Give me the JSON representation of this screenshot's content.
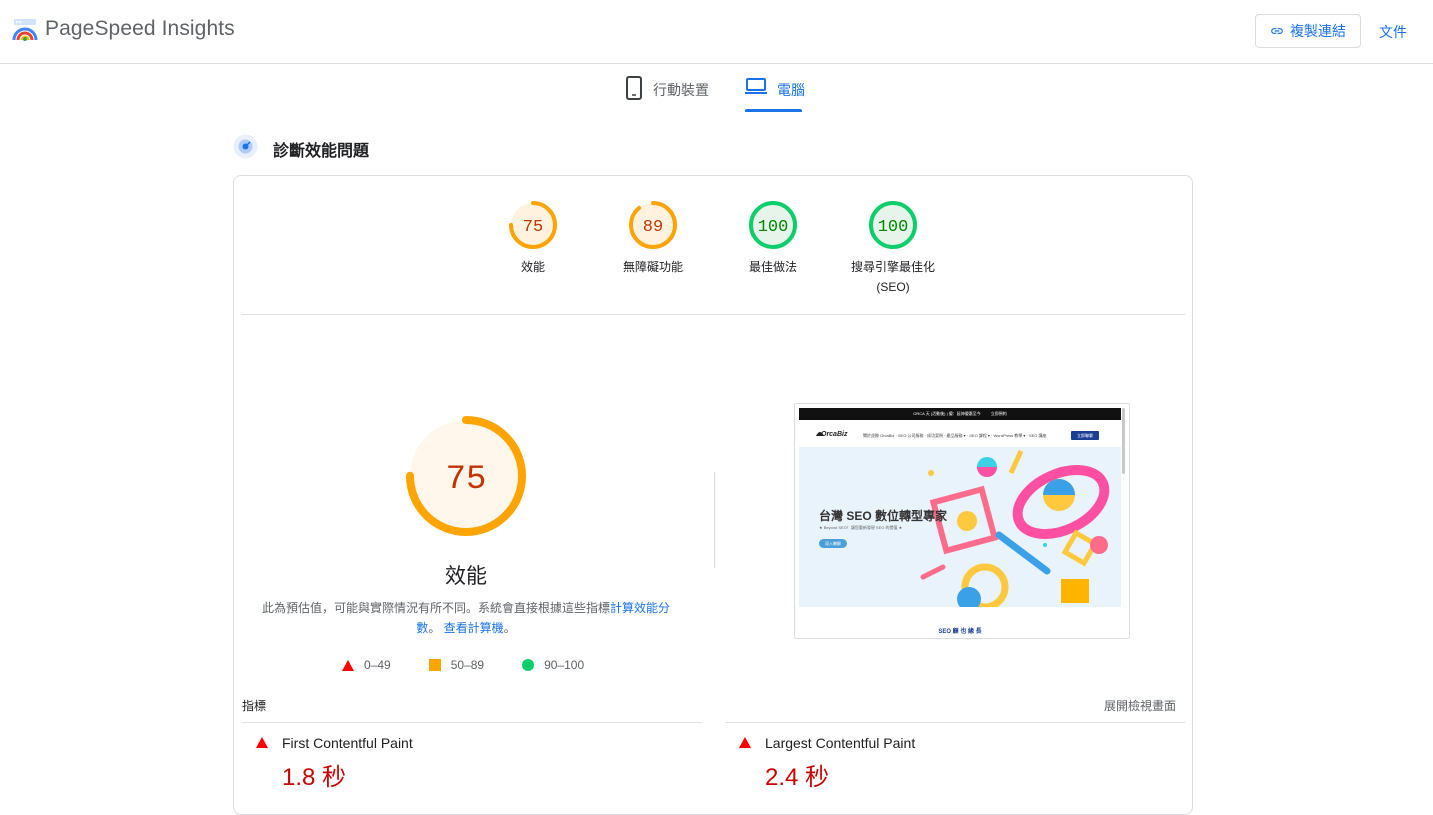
{
  "header": {
    "brand": "PageSpeed Insights",
    "copy_link_label": "複製連結",
    "docs_label": "文件"
  },
  "tabs": [
    {
      "label": "行動裝置",
      "icon": "smartphone-icon",
      "selected": false
    },
    {
      "label": "電腦",
      "icon": "laptop-icon",
      "selected": true
    }
  ],
  "diagnose": {
    "title": "診斷效能問題"
  },
  "scores": [
    {
      "value": "75",
      "label": "效能",
      "sublabel": "",
      "color": "#ffa400",
      "fill": "#fff3e0",
      "text_color": "#c33300",
      "progress": 0.75
    },
    {
      "value": "89",
      "label": "無障礙功能",
      "sublabel": "",
      "color": "#ffa400",
      "fill": "#fff3e0",
      "text_color": "#c33300",
      "progress": 0.89
    },
    {
      "value": "100",
      "label": "最佳做法",
      "sublabel": "",
      "color": "#0cce6b",
      "fill": "#e6f4ea",
      "text_color": "#008800",
      "progress": 1.0
    },
    {
      "value": "100",
      "label": "搜尋引擎最佳化",
      "sublabel": "(SEO)",
      "color": "#0cce6b",
      "fill": "#e6f4ea",
      "text_color": "#008800",
      "progress": 1.0
    }
  ],
  "performance": {
    "score": "75",
    "progress": 0.75,
    "title": "效能",
    "note_prefix": "此為預估值，可能與實際情況有所不同。系統會直接根據這些指標",
    "note_link1": "計算效能分數",
    "note_mid": "。",
    "note_link2": "查看計算機",
    "note_suffix": "。"
  },
  "legend": [
    {
      "range": "0–49",
      "shape": "triangle",
      "color": "#ff0000"
    },
    {
      "range": "50–89",
      "shape": "square",
      "color": "#ffa400"
    },
    {
      "range": "90–100",
      "shape": "circle",
      "color": "#0cce6b"
    }
  ],
  "preview": {
    "topbar": "ORCA 天 (活動後) | 優：延伸優惠至今",
    "topbar_btn": "立即預約",
    "brand": "OrcaBiz",
    "nav_links": "關於虎鯨 OrcaBiz  ·  SEO 公司服務  ·  成功案例  ·  產品服務 ▾  ·  SEO 課程 ▾  ·  WordPress 教學 ▾  ·  SEO 講座",
    "nav_btn": "立即聯繫",
    "hero_title": "台灣 SEO 數位轉型專家",
    "hero_sub": "★ Beyond SEO！讓您重新發現 SEO 的價值 ★",
    "hero_btn": "深入瞭解",
    "footer": "SEO 顧 也 緣 長"
  },
  "metrics": {
    "label": "指標",
    "expand": "展開檢視畫面",
    "items": [
      {
        "name": "First Contentful Paint",
        "value": "1.8 秒",
        "status_color": "#ff0000"
      },
      {
        "name": "Largest Contentful Paint",
        "value": "2.4 秒",
        "status_color": "#ff0000"
      }
    ]
  }
}
